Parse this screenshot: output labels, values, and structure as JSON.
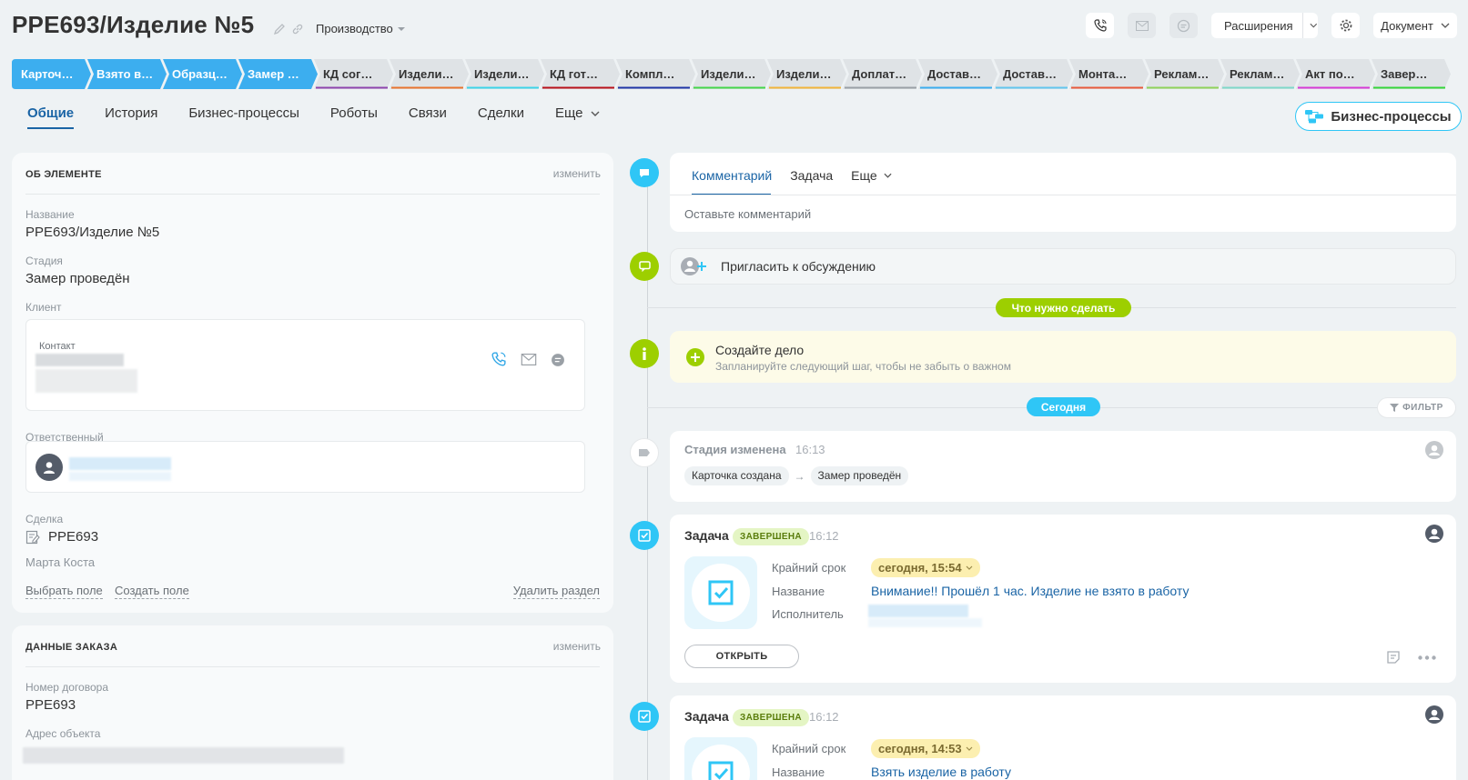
{
  "header": {
    "title": "PPE693/Изделие №5",
    "category": "Производство",
    "extensions_label": "Расширения",
    "document_label": "Документ"
  },
  "stages": [
    {
      "label": "Карточка создана",
      "short": "Карточ…",
      "color": "#3caeef",
      "active": true
    },
    {
      "label": "Взято в работу",
      "short": "Взято в…",
      "color": "#3caeef",
      "active": true
    },
    {
      "label": "Образцы",
      "short": "Образц…",
      "color": "#3caeef",
      "active": true
    },
    {
      "label": "Замер проведён",
      "short": "Замер …",
      "color": "#3caeef",
      "active": true
    },
    {
      "label": "КД согласовано",
      "short": "КД сог…",
      "color": "#8e44ad",
      "active": false
    },
    {
      "label": "Изделие",
      "short": "Издели…",
      "color": "#e8742e",
      "active": false
    },
    {
      "label": "Изделие",
      "short": "Издели…",
      "color": "#3dd4e8",
      "active": false
    },
    {
      "label": "КД готово",
      "short": "КД гот…",
      "color": "#b8121b",
      "active": false
    },
    {
      "label": "Комплектация",
      "short": "Компл…",
      "color": "#1f35a6",
      "active": false
    },
    {
      "label": "Изделие",
      "short": "Издели…",
      "color": "#45d64a",
      "active": false
    },
    {
      "label": "Изделие",
      "short": "Издели…",
      "color": "#f1b43a",
      "active": false
    },
    {
      "label": "Доплата",
      "short": "Доплат…",
      "color": "#9aa0a6",
      "active": false
    },
    {
      "label": "Доставка",
      "short": "Достав…",
      "color": "#3caeef",
      "active": false
    },
    {
      "label": "Доставка",
      "short": "Достав…",
      "color": "#62c6ee",
      "active": false
    },
    {
      "label": "Монтаж",
      "short": "Монта…",
      "color": "#e85a3b",
      "active": false
    },
    {
      "label": "Рекламация",
      "short": "Реклам…",
      "color": "#8fd35a",
      "active": false
    },
    {
      "label": "Рекламация",
      "short": "Реклам…",
      "color": "#7fd8c9",
      "active": false
    },
    {
      "label": "Акт подписан",
      "short": "Акт по…",
      "color": "#d63bd6",
      "active": false
    },
    {
      "label": "Завершено",
      "short": "Завер…",
      "color": "#35d63a",
      "active": false
    }
  ],
  "tabs": [
    "Общие",
    "История",
    "Бизнес-процессы",
    "Роботы",
    "Связи",
    "Сделки",
    "Еще"
  ],
  "bp_button": "Бизнес-процессы",
  "about": {
    "heading": "ОБ ЭЛЕМЕНТЕ",
    "edit": "изменить",
    "name_label": "Название",
    "name_value": "PPE693/Изделие №5",
    "stage_label": "Стадия",
    "stage_value": "Замер проведён",
    "client_label": "Клиент",
    "contact_label": "Контакт",
    "responsible_label": "Ответственный",
    "deal_label": "Сделка",
    "deal_value": "PPE693",
    "deal_person": "Марта Коста",
    "select_field": "Выбрать поле",
    "create_field": "Создать поле",
    "delete_section": "Удалить раздел"
  },
  "order": {
    "heading": "ДАННЫЕ ЗАКАЗА",
    "edit": "изменить",
    "contract_label": "Номер договора",
    "contract_value": "PPE693",
    "address_label": "Адрес объекта"
  },
  "timeline": {
    "comment_tabs": [
      "Комментарий",
      "Задача",
      "Еще"
    ],
    "comment_placeholder": "Оставьте комментарий",
    "invite": "Пригласить к обсуждению",
    "todo_pill": "Что нужно сделать",
    "create_title": "Создайте дело",
    "create_sub": "Запланируйте следующий шаг, чтобы не забыть о важном",
    "today_pill": "Сегодня",
    "filter": "ФИЛЬТР",
    "stage_change": {
      "title": "Стадия изменена",
      "time": "16:13",
      "from": "Карточка создана",
      "to": "Замер проведён"
    },
    "tasks": [
      {
        "title": "Задача",
        "badge": "ЗАВЕРШЕНА",
        "time": "16:12",
        "deadline_label": "Крайний срок",
        "deadline": "сегодня, 15:54",
        "name_label": "Название",
        "name": "Внимание!! Прошёл 1 час. Изделие не взято в работу",
        "executor_label": "Исполнитель",
        "open": "ОТКРЫТЬ"
      },
      {
        "title": "Задача",
        "badge": "ЗАВЕРШЕНА",
        "time": "16:12",
        "deadline_label": "Крайний срок",
        "deadline": "сегодня, 14:53",
        "name_label": "Название",
        "name": "Взять изделие в работу"
      }
    ]
  },
  "colors": {
    "accent": "#2fc6f6",
    "link": "#1a64a5",
    "green": "#9dcf00",
    "stage_active": "#3caeef"
  }
}
